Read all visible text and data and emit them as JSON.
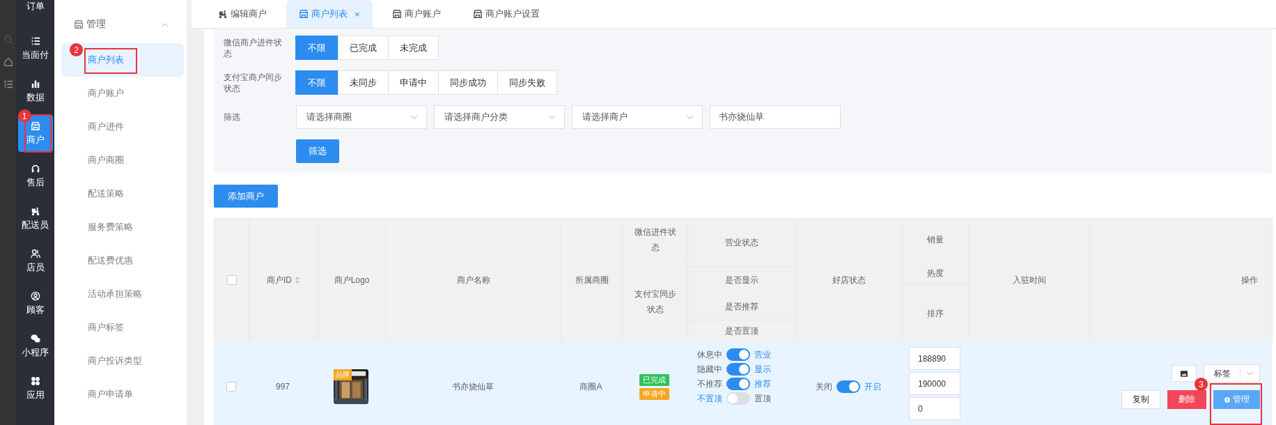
{
  "rail": {
    "items": [
      {
        "label": "订单",
        "selected": false
      },
      {
        "label": "当面付",
        "selected": false
      },
      {
        "label": "数据",
        "selected": false
      },
      {
        "label": "商户",
        "selected": true,
        "marker": "1"
      },
      {
        "label": "售后",
        "selected": false
      },
      {
        "label": "配送员",
        "selected": false
      },
      {
        "label": "店员",
        "selected": false
      },
      {
        "label": "顾客",
        "selected": false
      },
      {
        "label": "小程序",
        "selected": false
      },
      {
        "label": "应用",
        "selected": false
      }
    ]
  },
  "submenu": {
    "group": "管理",
    "expanded": true,
    "items": [
      {
        "label": "商户列表",
        "selected": true,
        "marker": "2"
      },
      {
        "label": "商户账户",
        "selected": false
      },
      {
        "label": "商户进件",
        "selected": false
      },
      {
        "label": "商户商圈",
        "selected": false
      },
      {
        "label": "配送策略",
        "selected": false
      },
      {
        "label": "服务费策略",
        "selected": false
      },
      {
        "label": "配送费优惠",
        "selected": false
      },
      {
        "label": "活动承担策略",
        "selected": false
      },
      {
        "label": "商户标签",
        "selected": false
      },
      {
        "label": "商户投诉类型",
        "selected": false
      },
      {
        "label": "商户申请单",
        "selected": false
      }
    ]
  },
  "tabs": [
    {
      "label": "编辑商户",
      "selected": false
    },
    {
      "label": "商户列表",
      "selected": true,
      "close": "×"
    },
    {
      "label": "商户账户",
      "selected": false
    },
    {
      "label": "商户账户设置",
      "selected": false
    }
  ],
  "filters": {
    "wechat": {
      "label": "微信商户进件状态",
      "options": [
        {
          "label": "不限",
          "selected": true
        },
        {
          "label": "已完成",
          "selected": false
        },
        {
          "label": "未完成",
          "selected": false
        }
      ]
    },
    "alipay": {
      "label": "支付宝商户同步状态",
      "options": [
        {
          "label": "不限",
          "selected": true
        },
        {
          "label": "未同步",
          "selected": false
        },
        {
          "label": "申请中",
          "selected": false
        },
        {
          "label": "同步成功",
          "selected": false
        },
        {
          "label": "同步失败",
          "selected": false
        }
      ]
    },
    "screen": {
      "label": "筛选",
      "selects": [
        {
          "placeholder": "请选择商圈"
        },
        {
          "placeholder": "请选择商户分类"
        },
        {
          "placeholder": "请选择商户"
        }
      ],
      "search": {
        "value": "书亦烧仙草"
      },
      "button": "筛选"
    }
  },
  "add_button": "添加商户",
  "table": {
    "all_checked": false,
    "header": {
      "id": "商户ID",
      "logo": "商户Logo",
      "name": "商户名称",
      "area": "所属商圈",
      "wechat": "微信进件状态",
      "alipay": "支付宝同步状态",
      "business": "营业状态",
      "show": "是否显示",
      "recommend": "是否推荐",
      "top": "是否置顶",
      "good": "好店状态",
      "sales": "销量",
      "heat": "热度",
      "sort": "排序",
      "joined": "入驻时间",
      "ops": "操作"
    },
    "rows": [
      {
        "checked": false,
        "id": "997",
        "logo_badge": "品牌",
        "name": "书亦烧仙草",
        "area": "商圈A",
        "statuses": [
          {
            "text": "已完成",
            "color": "#2fc25b"
          },
          {
            "text": "申请中",
            "color": "#f5a623"
          }
        ],
        "switches": [
          {
            "off": "休息中",
            "on": "营业",
            "checked": true
          },
          {
            "off": "隐藏中",
            "on": "显示",
            "checked": true
          },
          {
            "off": "不推荐",
            "on": "推荐",
            "checked": true
          },
          {
            "off": "不置顶",
            "on": "置顶",
            "checked": false
          }
        ],
        "good": {
          "off": "关闭",
          "on": "开启",
          "checked": true
        },
        "numbers": [
          "188890",
          "190000",
          "0"
        ],
        "actions": {
          "tag": "标签",
          "copy": "复制",
          "delete": "删除",
          "manage": "管理",
          "marker": "3"
        }
      }
    ]
  }
}
